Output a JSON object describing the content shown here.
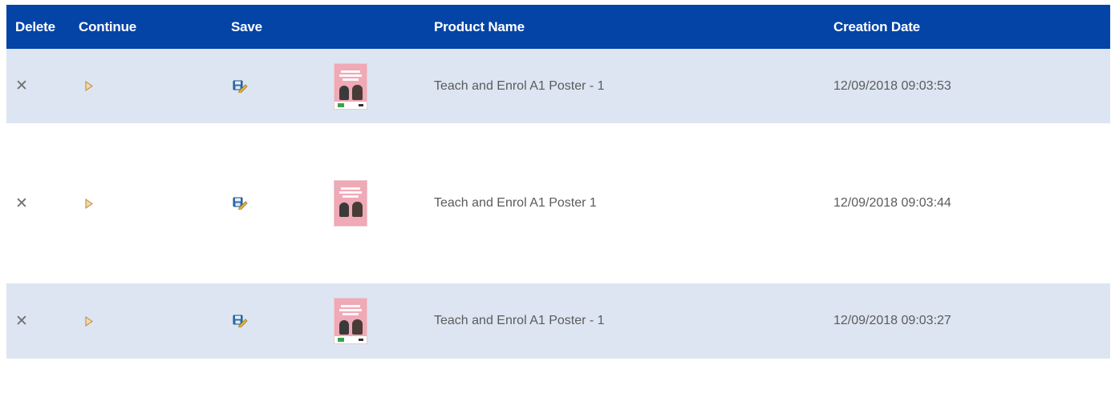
{
  "table": {
    "headers": {
      "delete": "Delete",
      "continue": "Continue",
      "save": "Save",
      "product_name": "Product Name",
      "creation_date": "Creation Date"
    },
    "rows": [
      {
        "product_name": "Teach and Enrol A1 Poster - 1",
        "creation_date": "12/09/2018 09:03:53"
      },
      {
        "product_name": "Teach and Enrol A1 Poster 1",
        "creation_date": "12/09/2018 09:03:44"
      },
      {
        "product_name": "Teach and Enrol A1 Poster - 1",
        "creation_date": "12/09/2018 09:03:27"
      }
    ]
  },
  "icons": {
    "delete": "close-icon",
    "continue": "play-icon",
    "save": "save-edit-icon",
    "thumbnail": "poster-thumbnail"
  },
  "colors": {
    "header_bg": "#0444a6",
    "header_text": "#ffffff",
    "row_alt_bg": "#dde5f2",
    "row_text": "#5b5b5b"
  }
}
